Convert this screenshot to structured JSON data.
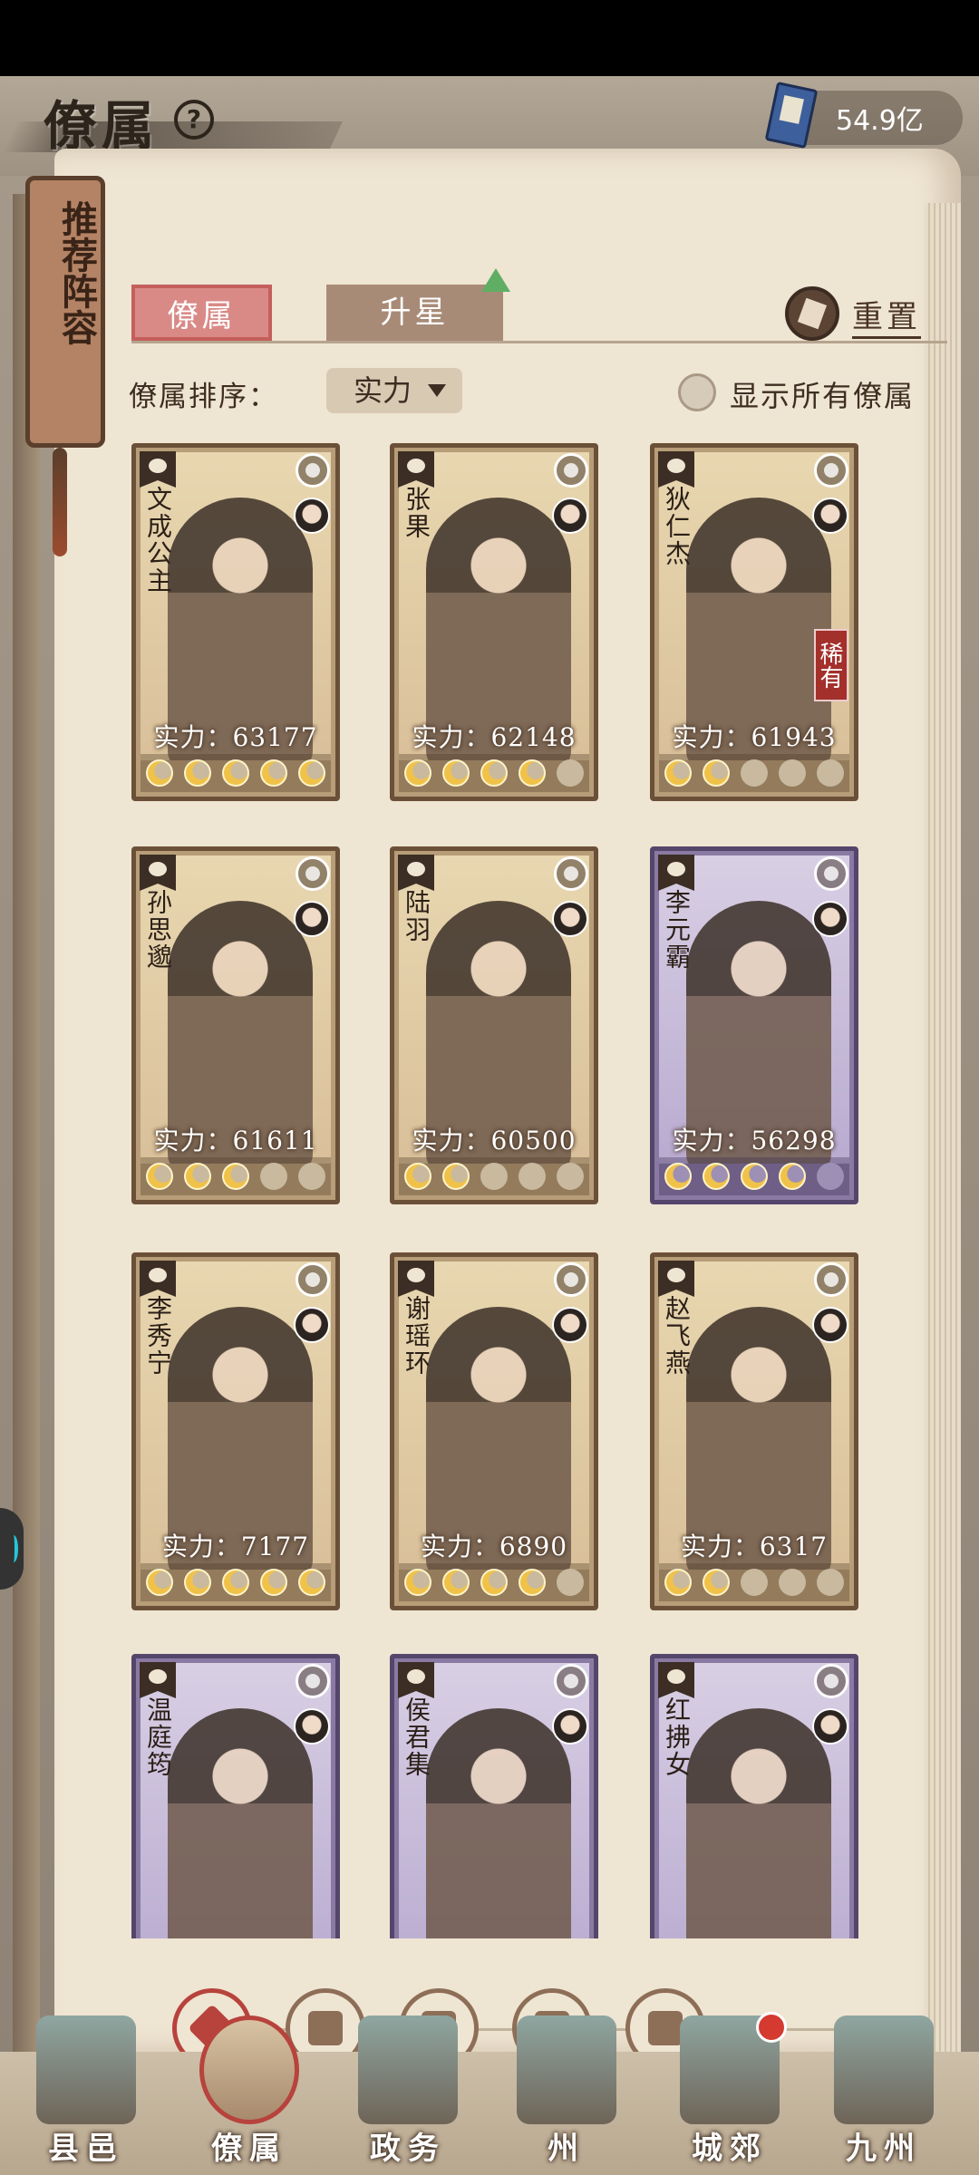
{
  "header": {
    "title": "僚属",
    "help": "?",
    "currency_value": "54.9亿"
  },
  "recommend": {
    "label": "推荐阵容"
  },
  "tabs": [
    {
      "label": "僚属",
      "active": true
    },
    {
      "label": "升星",
      "active": false
    }
  ],
  "reset_label": "重置",
  "sort": {
    "label": "僚属排序：",
    "value": "实力"
  },
  "show_all": {
    "label": "显示所有僚属",
    "checked": false
  },
  "cards": [
    {
      "name": "文成公主",
      "power": "实力：63177",
      "stars": 5,
      "max_stars": 5,
      "tier": "gold",
      "rare": ""
    },
    {
      "name": "张果",
      "power": "实力：62148",
      "stars": 4,
      "max_stars": 5,
      "tier": "gold",
      "rare": ""
    },
    {
      "name": "狄仁杰",
      "power": "实力：61943",
      "stars": 2,
      "max_stars": 5,
      "tier": "gold",
      "rare": "稀有"
    },
    {
      "name": "孙思邈",
      "power": "实力：61611",
      "stars": 3,
      "max_stars": 5,
      "tier": "gold",
      "rare": ""
    },
    {
      "name": "陆羽",
      "power": "实力：60500",
      "stars": 2,
      "max_stars": 5,
      "tier": "gold",
      "rare": ""
    },
    {
      "name": "李元霸",
      "power": "实力：56298",
      "stars": 4,
      "max_stars": 5,
      "tier": "purple",
      "rare": ""
    },
    {
      "name": "李秀宁",
      "power": "实力：7177",
      "stars": 5,
      "max_stars": 5,
      "tier": "gold",
      "rare": ""
    },
    {
      "name": "谢瑶环",
      "power": "实力：6890",
      "stars": 4,
      "max_stars": 5,
      "tier": "gold",
      "rare": ""
    },
    {
      "name": "赵飞燕",
      "power": "实力：6317",
      "stars": 2,
      "max_stars": 5,
      "tier": "gold",
      "rare": ""
    },
    {
      "name": "温庭筠",
      "power": "",
      "stars": 0,
      "max_stars": 5,
      "tier": "purple",
      "rare": ""
    },
    {
      "name": "侯君集",
      "power": "",
      "stars": 0,
      "max_stars": 5,
      "tier": "purple",
      "rare": ""
    },
    {
      "name": "红拂女",
      "power": "",
      "stars": 0,
      "max_stars": 5,
      "tier": "purple",
      "rare": ""
    }
  ],
  "filters": [
    {
      "icon": "all-filter-icon",
      "active": true
    },
    {
      "icon": "bell-filter-icon",
      "active": false
    },
    {
      "icon": "gourd-filter-icon",
      "active": false
    },
    {
      "icon": "fan-filter-icon",
      "active": false
    },
    {
      "icon": "lion-filter-icon",
      "active": false
    }
  ],
  "bottom_nav": [
    {
      "label": "县邑",
      "active": false,
      "notify": false
    },
    {
      "label": "僚属",
      "active": true,
      "notify": false
    },
    {
      "label": "政务",
      "active": false,
      "notify": false
    },
    {
      "label": "州",
      "active": false,
      "notify": false
    },
    {
      "label": "城郊",
      "active": false,
      "notify": true
    },
    {
      "label": "九州",
      "active": false,
      "notify": false
    }
  ],
  "colors": {
    "accent_red": "#b7433c",
    "gold_card": "#b79d78",
    "purple_card": "#8a7aa3",
    "star_on": "#f0c24a"
  }
}
